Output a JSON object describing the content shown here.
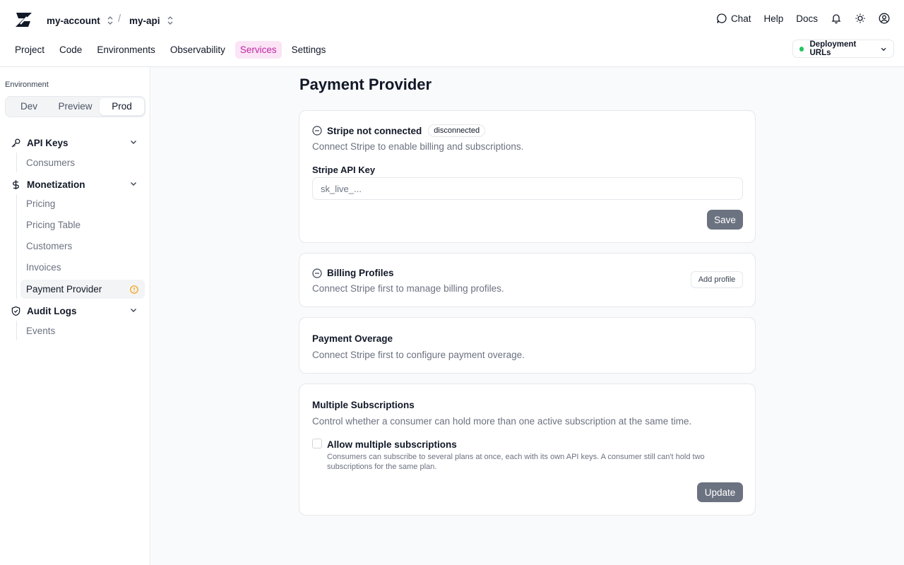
{
  "header": {
    "account": "my-account",
    "separator": "/",
    "project": "my-api",
    "links": {
      "chat": "Chat",
      "help": "Help",
      "docs": "Docs"
    },
    "icons": [
      "chat-bubble-icon",
      "bell-icon",
      "sun-icon",
      "user-circle-icon"
    ]
  },
  "nav": {
    "tabs": [
      "Project",
      "Code",
      "Environments",
      "Observability",
      "Services",
      "Settings"
    ],
    "active": "Services",
    "active_color": "#c026a3",
    "deployment_urls": "Deployment URLs",
    "status_color": "#22c55e"
  },
  "sidebar": {
    "env_label": "Environment",
    "env_options": [
      "Dev",
      "Preview",
      "Prod"
    ],
    "env_selected": "Prod",
    "groups": [
      {
        "label": "API Keys",
        "icon": "key-icon",
        "items": [
          "Consumers"
        ]
      },
      {
        "label": "Monetization",
        "icon": "dollar-icon",
        "items": [
          "Pricing",
          "Pricing Table",
          "Customers",
          "Invoices",
          "Payment Provider"
        ]
      },
      {
        "label": "Audit Logs",
        "icon": "shield-icon",
        "items": [
          "Events"
        ]
      }
    ],
    "active_item": "Payment Provider",
    "warning_color": "#f59e0b"
  },
  "main": {
    "title": "Payment Provider",
    "stripe": {
      "title": "Stripe not connected",
      "badge": "disconnected",
      "desc": "Connect Stripe to enable billing and subscriptions.",
      "key_label": "Stripe API Key",
      "key_placeholder": "sk_live_...",
      "save": "Save"
    },
    "billing": {
      "title": "Billing Profiles",
      "desc": "Connect Stripe first to manage billing profiles.",
      "add": "Add profile"
    },
    "overage": {
      "title": "Payment Overage",
      "desc": "Connect Stripe first to configure payment overage."
    },
    "subscriptions": {
      "title": "Multiple Subscriptions",
      "desc": "Control whether a consumer can hold more than one active subscription at the same time.",
      "checkbox_label": "Allow multiple subscriptions",
      "checkbox_help": "Consumers can subscribe to several plans at once, each with its own API keys. A consumer still can't hold two subscriptions for the same plan.",
      "checked": false,
      "update": "Update"
    }
  }
}
